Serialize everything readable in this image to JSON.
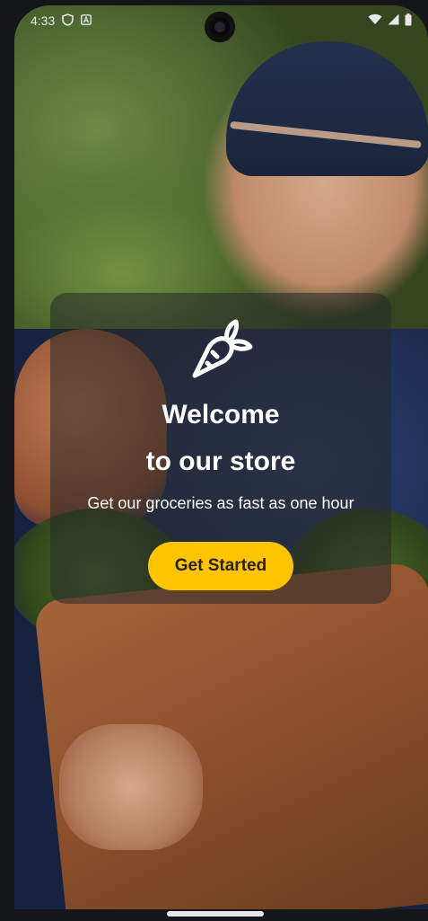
{
  "status": {
    "time": "4:33",
    "left_icons": [
      "shield-icon",
      "a-icon"
    ],
    "right_icons": [
      "wifi-icon",
      "signal-icon",
      "battery-icon"
    ]
  },
  "welcome": {
    "title_line1": "Welcome",
    "title_line2": "to our store",
    "subtitle": "Get our groceries as fast as one hour",
    "cta_label": "Get Started",
    "logo_icon": "carrot-icon"
  },
  "colors": {
    "accent": "#ffc400",
    "card_overlay": "rgba(40,40,40,0.55)",
    "text": "#ffffff"
  }
}
